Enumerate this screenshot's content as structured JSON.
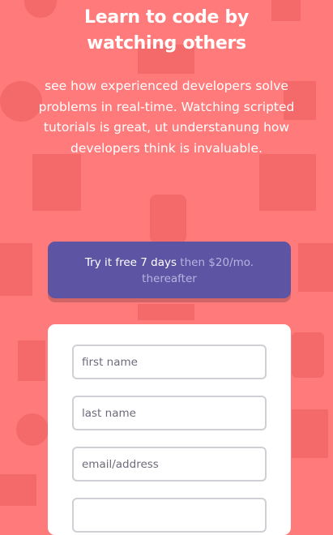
{
  "hero": {
    "headline_line1": "Learn to code by",
    "headline_line2": "watching others",
    "description": "see how experienced developers solve problems in real-time. Watching scripted tutorials is great, ut understanung how developers think is invaluable."
  },
  "trial": {
    "offer": "Try it free 7 days",
    "price": "then $20/mo.",
    "suffix": "thereafter"
  },
  "form": {
    "first_name_placeholder": "first name",
    "last_name_placeholder": "last name",
    "email_placeholder": "email/address",
    "password_placeholder": ""
  },
  "colors": {
    "background": "#ff7a7a",
    "banner": "#5e54a4",
    "card": "#ffffff",
    "input_border": "#cfcfd6"
  }
}
